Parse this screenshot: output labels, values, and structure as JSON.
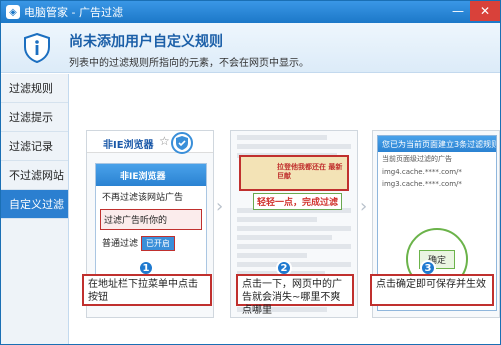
{
  "window": {
    "title": "电脑管家 - 广告过滤",
    "controls": {
      "minimize": "—",
      "close": "✕"
    }
  },
  "header": {
    "title": "尚未添加用户自定义规则",
    "description": "列表中的过滤规则所指向的元素，不会在网页中显示。"
  },
  "sidebar": {
    "items": [
      {
        "label": "过滤规则"
      },
      {
        "label": "过滤提示"
      },
      {
        "label": "过滤记录"
      },
      {
        "label": "不过滤网站"
      },
      {
        "label": "自定义过滤"
      }
    ],
    "active_index": 4
  },
  "steps": [
    {
      "number": "1",
      "caption": "在地址栏下拉菜单中点击按钮",
      "browser_logo": "非IE浏览器",
      "panel_title": "非IE浏览器",
      "menu": [
        "不再过滤该网站广告",
        "过滤广告听你的",
        "普通过滤"
      ],
      "menu_button": "已开启"
    },
    {
      "number": "2",
      "caption": "点击一下，网页中的广告就会消失~哪里不爽点哪里",
      "ad_text": "拉登他我都还在 最新巨献",
      "slogan": "轻轻一点，完成过滤"
    },
    {
      "number": "3",
      "caption": "点击确定即可保存并生效",
      "dialog_title": "您已为当前页面建立3条过滤规则",
      "rows": [
        "当前页面级过滤的广告",
        "img4.cache.****.com/*",
        "img3.cache.****.com/*"
      ],
      "confirm": "确定"
    }
  ],
  "colors": {
    "accent": "#2b7fd0",
    "highlight": "#c0302e"
  }
}
